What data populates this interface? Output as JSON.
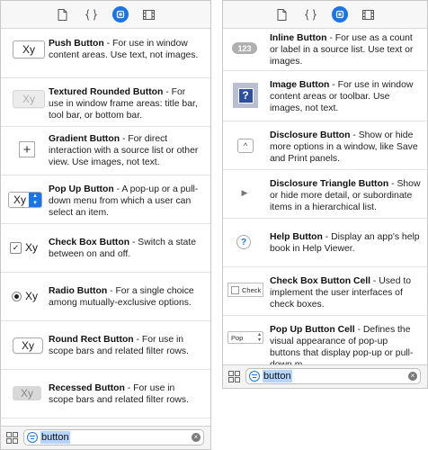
{
  "left": {
    "items": [
      {
        "title": "Push Button",
        "desc": " - For use in window content areas. Use text, not images.",
        "thumb": "Xy"
      },
      {
        "title": "Textured Rounded Button",
        "desc": " - For use in window frame areas: title bar, tool bar, or bottom bar.",
        "thumb": "Xy"
      },
      {
        "title": "Gradient Button",
        "desc": " - For direct interaction with a source list or other view. Use images, not text.",
        "thumb": "+"
      },
      {
        "title": "Pop Up Button",
        "desc": " - A pop-up or a pull-down menu from which a user can select an item.",
        "thumb": "Xy"
      },
      {
        "title": "Check Box Button",
        "desc": " - Switch a state between on and off.",
        "thumb": "Xy"
      },
      {
        "title": "Radio Button",
        "desc": " - For a single choice among mutually-exclusive options.",
        "thumb": "Xy"
      },
      {
        "title": "Round Rect Button",
        "desc": " - For use in scope bars and related filter rows.",
        "thumb": "Xy"
      },
      {
        "title": "Recessed Button",
        "desc": " - For use in scope bars and related filter rows.",
        "thumb": "Xy"
      }
    ],
    "search": "button",
    "clear": "×"
  },
  "right": {
    "items": [
      {
        "title": "Inline Button",
        "desc": " - For use as a count or label in a source list. Use text or images.",
        "thumb": "123"
      },
      {
        "title": "Image Button",
        "desc": " - For use in window content areas or toolbar. Use images, not text.",
        "thumb": "?"
      },
      {
        "title": "Disclosure Button",
        "desc": " - Show or hide more options in a window, like Save and Print panels.",
        "thumb": "^"
      },
      {
        "title": "Disclosure Triangle Button",
        "desc": " - Show or hide more detail, or subordinate items in a hierarchical list.",
        "thumb": "▶"
      },
      {
        "title": "Help Button",
        "desc": " - Display an app's help book in Help Viewer.",
        "thumb": "?"
      },
      {
        "title": "Check Box Button Cell",
        "desc": " - Used to implement the user interfaces of check boxes.",
        "thumb": "Check"
      },
      {
        "title": "Pop Up Button Cell",
        "desc": " - Defines the visual appearance of pop-up buttons that display pop-up or pull-down m...",
        "thumb": "Pop"
      }
    ],
    "search": "button",
    "clear": "×"
  },
  "colors": {
    "accent": "#1a73e8",
    "selection": "#b5d5ff"
  },
  "icons": [
    "file-icon",
    "braces-icon",
    "object-library-icon",
    "media-icon",
    "grid-icon",
    "filter-icon",
    "clear-icon"
  ]
}
